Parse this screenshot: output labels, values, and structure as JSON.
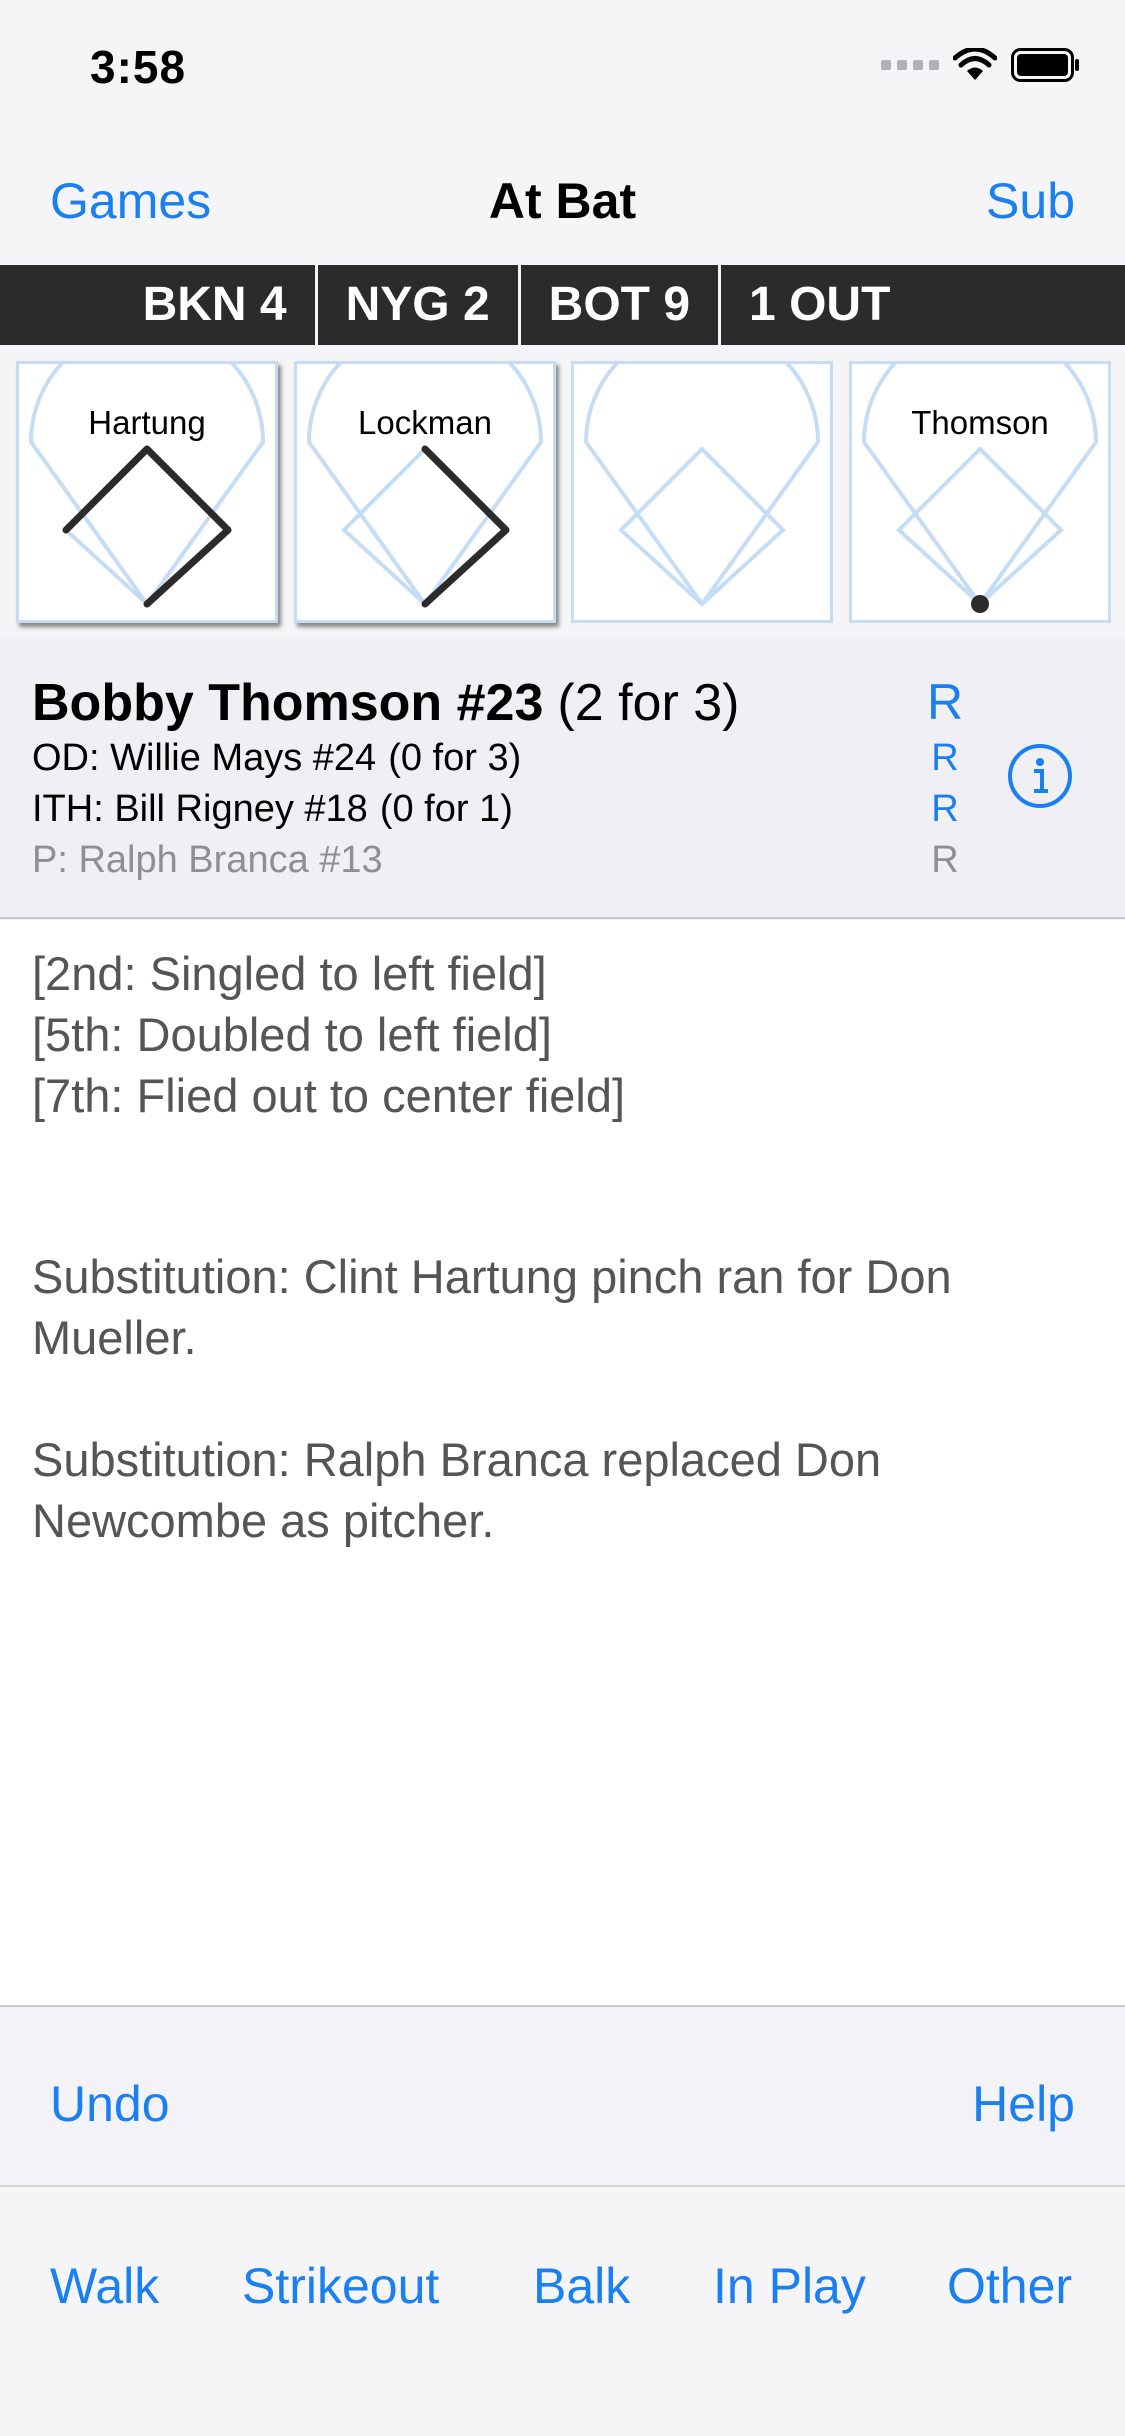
{
  "status_bar": {
    "time": "3:58"
  },
  "nav": {
    "left_label": "Games",
    "title": "At Bat",
    "right_label": "Sub"
  },
  "scoreboard": [
    "BKN 4",
    "NYG 2",
    "BOT 9",
    "1 OUT"
  ],
  "diamonds": [
    {
      "runner": "Hartung"
    },
    {
      "runner": "Lockman"
    },
    {
      "runner": ""
    },
    {
      "runner": "Thomson"
    }
  ],
  "batter": {
    "name": "Bobby Thomson #23",
    "stat": "(2 for 3)",
    "hand": "R"
  },
  "on_deck": {
    "name": "OD: Willie Mays #24",
    "stat": "(0 for 3)",
    "hand": "R"
  },
  "in_hole": {
    "name": "ITH: Bill Rigney #18",
    "stat": "(0 for 1)",
    "hand": "R"
  },
  "pitcher": {
    "name": "P: Ralph Branca #13",
    "hand": "R"
  },
  "log": {
    "at_bats": [
      "[2nd: Singled to left field]",
      "[5th: Doubled to left field]",
      "[7th: Flied out to center field]"
    ],
    "substitutions": [
      "Substitution: Clint Hartung pinch ran for Don Mueller.",
      "Substitution: Ralph Branca replaced Don Newcombe as pitcher."
    ]
  },
  "toolbar": {
    "undo": "Undo",
    "help": "Help"
  },
  "actions": [
    "Walk",
    "Strikeout",
    "Balk",
    "In Play",
    "Other"
  ],
  "colors": {
    "accent": "#1a7ff0",
    "scoreboard_bg": "#2b2b2b",
    "diamond_line": "#c5dcf5"
  }
}
